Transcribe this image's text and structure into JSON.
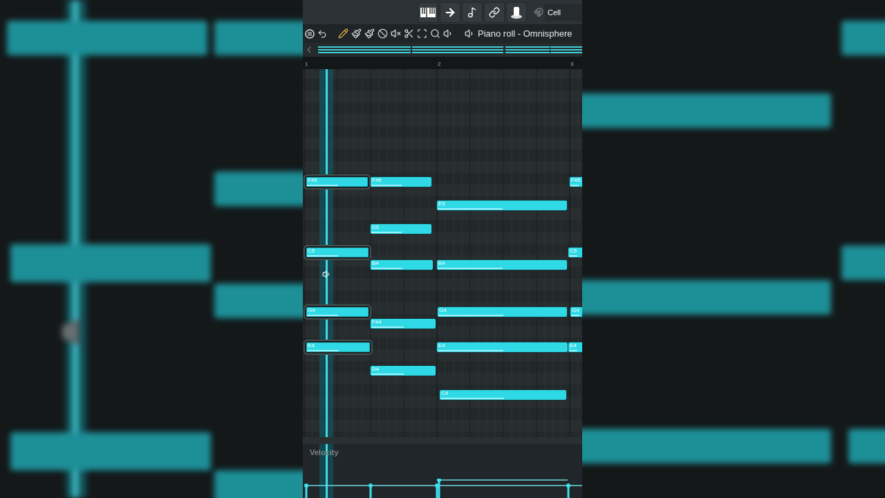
{
  "toolbar": {
    "snap": "Cell",
    "title": "Piano roll - Omnisphere"
  },
  "ruler": [
    "1",
    "2",
    "3"
  ],
  "notes": [
    {
      "label": "F#5",
      "selected": true
    },
    {
      "label": "F#5",
      "selected": false
    },
    {
      "label": "F#5",
      "selected": false
    },
    {
      "label": "E5",
      "selected": false
    },
    {
      "label": "D5",
      "selected": false
    },
    {
      "label": "C5",
      "selected": true
    },
    {
      "label": "C5",
      "selected": false
    },
    {
      "label": "B4",
      "selected": false
    },
    {
      "label": "B4",
      "selected": false
    },
    {
      "label": "G4",
      "selected": true
    },
    {
      "label": "G4",
      "selected": false
    },
    {
      "label": "G4",
      "selected": false
    },
    {
      "label": "F#4",
      "selected": false
    },
    {
      "label": "E4",
      "selected": true
    },
    {
      "label": "E4",
      "selected": false
    },
    {
      "label": "E4",
      "selected": false
    },
    {
      "label": "D4",
      "selected": false
    },
    {
      "label": "C4",
      "selected": false
    }
  ],
  "event_editor": {
    "label": "Velocity"
  }
}
